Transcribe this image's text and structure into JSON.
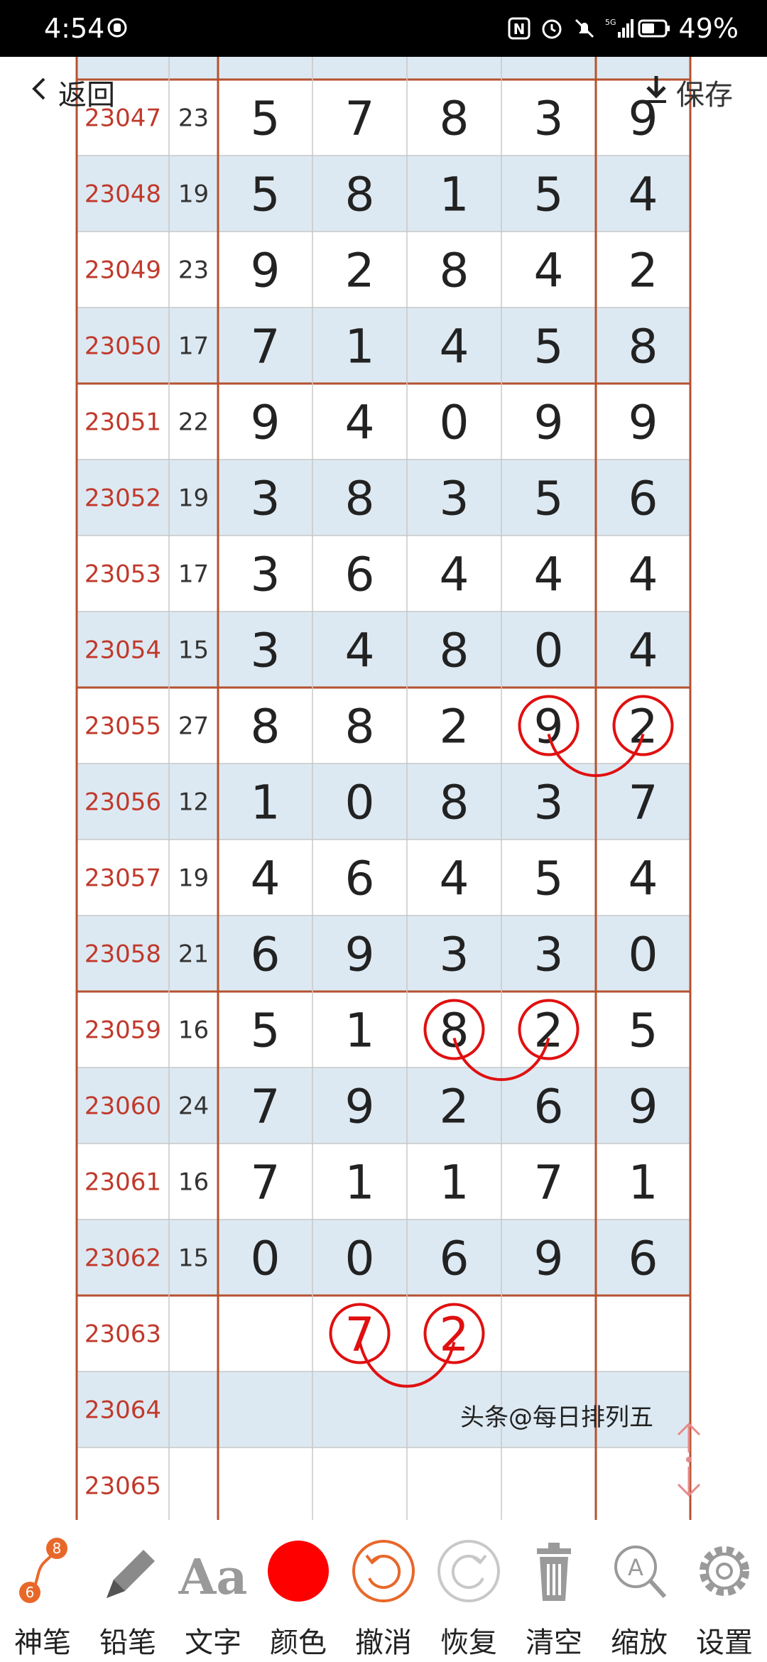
{
  "status_bar": {
    "time": "4:54",
    "battery": "49%",
    "network": "5G"
  },
  "nav": {
    "back_label": "返回",
    "save_label": "保存"
  },
  "colors": {
    "period_text": "#c0392b",
    "grid_line": "#c8c8c8",
    "group_border": "#b5522f",
    "row_alt": "#dde9f2",
    "marker": "#e01010",
    "accent_orange": "#e8682a"
  },
  "table": {
    "rows": [
      {
        "period": "23047",
        "sum": "23",
        "digits": [
          "5",
          "7",
          "8",
          "3",
          "9"
        ]
      },
      {
        "period": "23048",
        "sum": "19",
        "digits": [
          "5",
          "8",
          "1",
          "5",
          "4"
        ]
      },
      {
        "period": "23049",
        "sum": "23",
        "digits": [
          "9",
          "2",
          "8",
          "4",
          "2"
        ]
      },
      {
        "period": "23050",
        "sum": "17",
        "digits": [
          "7",
          "1",
          "4",
          "5",
          "8"
        ]
      },
      {
        "period": "23051",
        "sum": "22",
        "digits": [
          "9",
          "4",
          "0",
          "9",
          "9"
        ]
      },
      {
        "period": "23052",
        "sum": "19",
        "digits": [
          "3",
          "8",
          "3",
          "5",
          "6"
        ]
      },
      {
        "period": "23053",
        "sum": "17",
        "digits": [
          "3",
          "6",
          "4",
          "4",
          "4"
        ]
      },
      {
        "period": "23054",
        "sum": "15",
        "digits": [
          "3",
          "4",
          "8",
          "0",
          "4"
        ]
      },
      {
        "period": "23055",
        "sum": "27",
        "digits": [
          "8",
          "8",
          "2",
          "9",
          "2"
        ]
      },
      {
        "period": "23056",
        "sum": "12",
        "digits": [
          "1",
          "0",
          "8",
          "3",
          "7"
        ]
      },
      {
        "period": "23057",
        "sum": "19",
        "digits": [
          "4",
          "6",
          "4",
          "5",
          "4"
        ]
      },
      {
        "period": "23058",
        "sum": "21",
        "digits": [
          "6",
          "9",
          "3",
          "3",
          "0"
        ]
      },
      {
        "period": "23059",
        "sum": "16",
        "digits": [
          "5",
          "1",
          "8",
          "2",
          "5"
        ]
      },
      {
        "period": "23060",
        "sum": "24",
        "digits": [
          "7",
          "9",
          "2",
          "6",
          "9"
        ]
      },
      {
        "period": "23061",
        "sum": "16",
        "digits": [
          "7",
          "1",
          "1",
          "7",
          "1"
        ]
      },
      {
        "period": "23062",
        "sum": "15",
        "digits": [
          "0",
          "0",
          "6",
          "9",
          "6"
        ]
      },
      {
        "period": "23063",
        "sum": "",
        "digits": [
          "",
          "",
          "",
          "",
          ""
        ]
      },
      {
        "period": "23064",
        "sum": "",
        "digits": [
          "",
          "",
          "",
          "",
          ""
        ]
      },
      {
        "period": "23065",
        "sum": "",
        "digits": [
          "",
          "",
          "",
          "",
          ""
        ]
      }
    ],
    "annotations": [
      {
        "row": 8,
        "cols": [
          3,
          4
        ]
      },
      {
        "row": 12,
        "cols": [
          2,
          3
        ]
      }
    ],
    "predicted": {
      "row": 16,
      "values": [
        {
          "col": 1,
          "digit": "7"
        },
        {
          "col": 2,
          "digit": "2"
        }
      ]
    }
  },
  "watermark": "头条@每日排列五",
  "toolbar": {
    "pen_badges": [
      "8",
      "6"
    ],
    "items": [
      {
        "label": "神笔",
        "icon": "magic-pen-icon"
      },
      {
        "label": "铅笔",
        "icon": "pencil-icon"
      },
      {
        "label": "文字",
        "icon": "text-aa-icon"
      },
      {
        "label": "颜色",
        "icon": "color-dot-icon"
      },
      {
        "label": "撤消",
        "icon": "undo-icon"
      },
      {
        "label": "恢复",
        "icon": "redo-icon"
      },
      {
        "label": "清空",
        "icon": "trash-icon"
      },
      {
        "label": "缩放",
        "icon": "zoom-icon"
      },
      {
        "label": "设置",
        "icon": "gear-icon"
      }
    ]
  }
}
